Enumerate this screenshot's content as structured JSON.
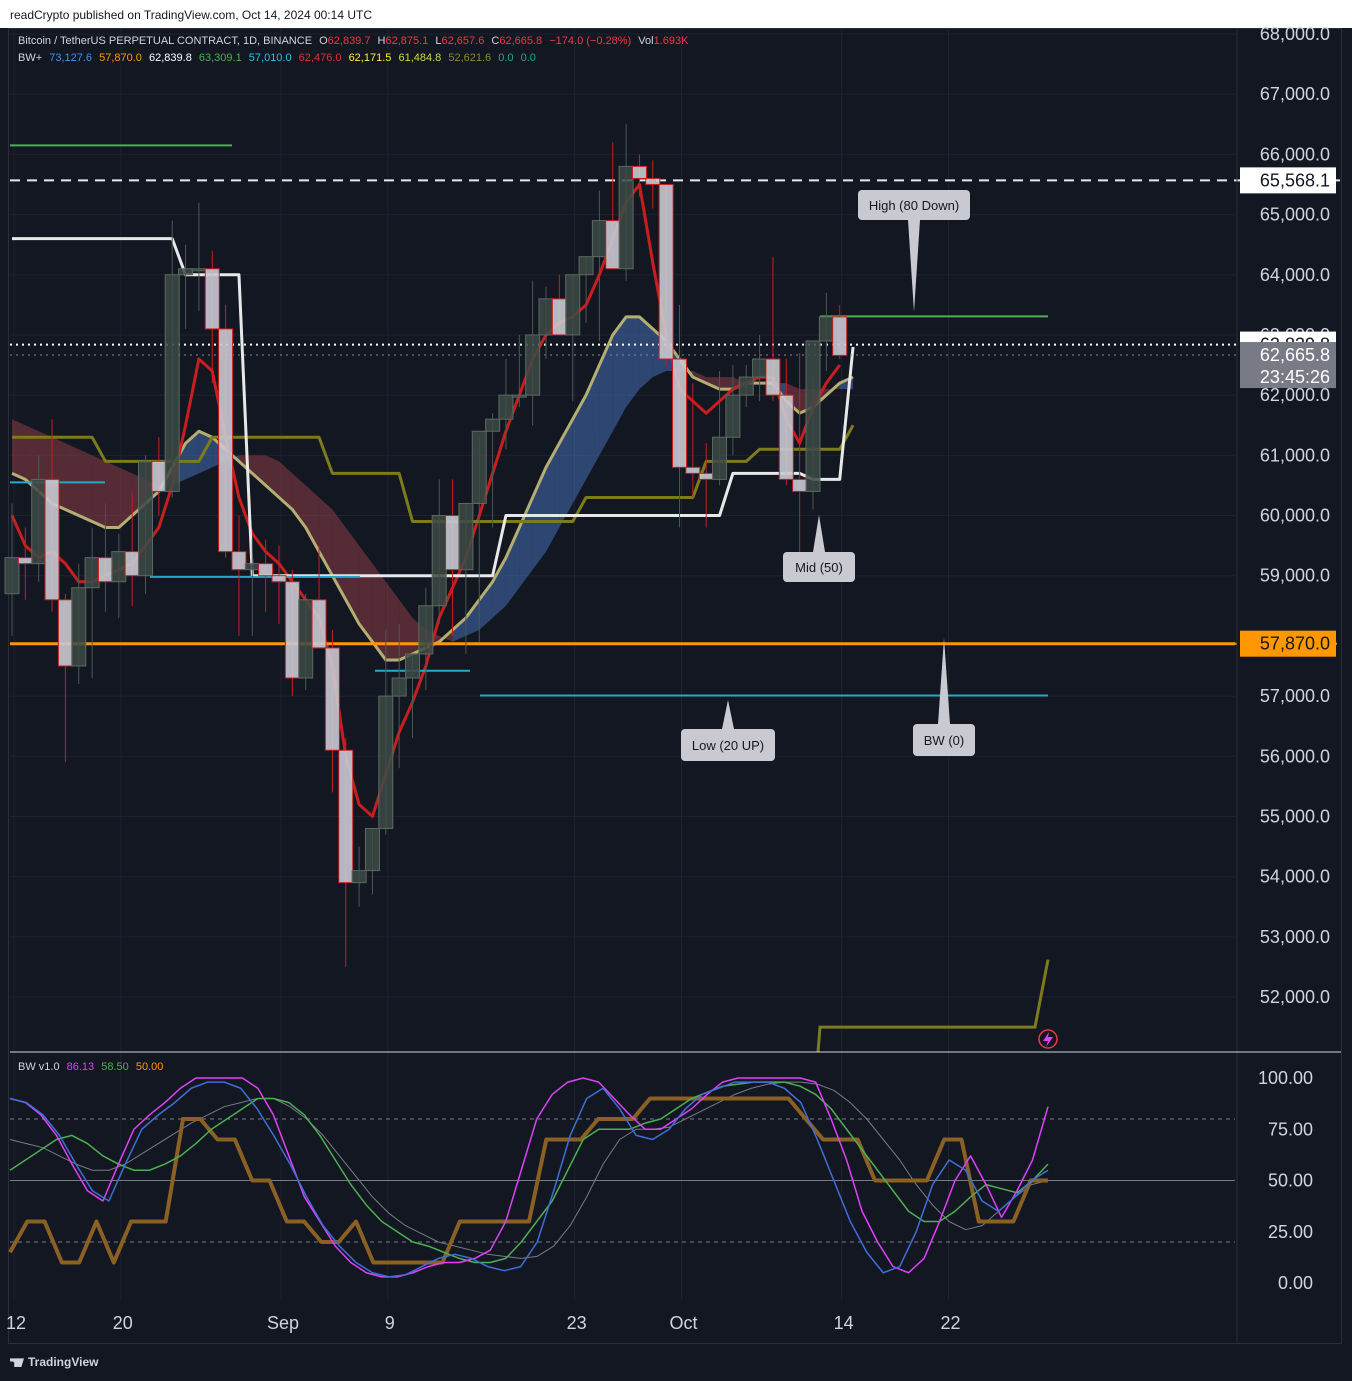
{
  "publisher": "readCrypto published on TradingView.com, Oct 14, 2024 00:14 UTC",
  "footer_brand": "TradingView",
  "colors": {
    "bg": "#131722",
    "up": "#4a5a50",
    "down": "#c8c8d0",
    "red": "#d11a1a",
    "white": "#e8e8e8",
    "olive": "#7d7b1b",
    "cyan": "#22aacc",
    "orange": "#ff9800",
    "green": "#4caf50",
    "pink": "#e040fb",
    "blue": "#3f6fd6",
    "ltgreen": "#6de05a",
    "brown": "#8a6023"
  },
  "legend": {
    "symbol": "Bitcoin / TetherUS PERPETUAL CONTRACT, 1D, BINANCE",
    "o_label": "O",
    "o": "62,839.7",
    "h_label": "H",
    "h": "62,875.1",
    "l_label": "L",
    "l": "62,657.6",
    "c_label": "C",
    "c": "62,665.8",
    "change": "−174.0 (−0.28%)",
    "vol_label": "Vol",
    "vol": "1.693K",
    "bw_label": "BW+",
    "bw_values": [
      "73,127.6",
      "57,870.0",
      "62,839.8",
      "63,309.1",
      "57,010.0",
      "62,476.0",
      "62,171.5",
      "61,484.8",
      "52,621.6",
      "0.0",
      "0.0"
    ],
    "bw_colors": [
      "#3f8ff6",
      "#ff9800",
      "#ffffff",
      "#4caf50",
      "#22c3e6",
      "#e03030",
      "#ffeb3b",
      "#cddc39",
      "#8a8a2a",
      "#22aa88",
      "#22aa88"
    ]
  },
  "osc_legend": {
    "name": "BW v1.0",
    "values": [
      "86.13",
      "58.50",
      "50.00"
    ],
    "colors": [
      "#e040fb",
      "#4caf50",
      "#ff9800"
    ]
  },
  "annotations": {
    "high": "High (80 Down)",
    "mid": "Mid (50)",
    "low": "Low (20 UP)",
    "bw": "BW (0)"
  },
  "price_badges": {
    "level_1": "65,568.1",
    "last": "62,839.8",
    "close": "62,665.8",
    "countdown": "23:45:26",
    "bw": "57,870.0"
  },
  "chart_data": [
    {
      "type": "candlestick",
      "title": "Bitcoin / TetherUS PERPETUAL CONTRACT, 1D, BINANCE",
      "y_ticks": [
        "68,000.0",
        "67,000.0",
        "66,000.0",
        "65,000.0",
        "64,000.0",
        "63,000.0",
        "62,000.0",
        "61,000.0",
        "60,000.0",
        "59,000.0",
        "57,000.0",
        "56,000.0",
        "55,000.0",
        "54,000.0",
        "53,000.0",
        "52,000.0"
      ],
      "y_tick_values": [
        68000,
        67000,
        66000,
        65000,
        64000,
        63000,
        62000,
        61000,
        60000,
        59000,
        57000,
        56000,
        55000,
        54000,
        53000,
        52000
      ],
      "x_ticks": [
        "12",
        "20",
        "Sep",
        "9",
        "23",
        "Oct",
        "14",
        "22"
      ],
      "x_tick_days": [
        0,
        8,
        20,
        28,
        42,
        50,
        62,
        70
      ],
      "ylim": [
        51100,
        68400
      ],
      "candles": [
        [
          58700,
          60200,
          58000,
          59300
        ],
        [
          59300,
          59800,
          58600,
          59200
        ],
        [
          59200,
          61000,
          58900,
          60600
        ],
        [
          60600,
          61600,
          58400,
          58600
        ],
        [
          58600,
          58700,
          55900,
          57500
        ],
        [
          57500,
          59200,
          57200,
          58800
        ],
        [
          58800,
          59800,
          57300,
          59300
        ],
        [
          59300,
          60200,
          58400,
          58900
        ],
        [
          58900,
          59700,
          58300,
          59400
        ],
        [
          59400,
          60400,
          58500,
          59000
        ],
        [
          59000,
          61000,
          58700,
          60900
        ],
        [
          60900,
          61300,
          60000,
          60400
        ],
        [
          60400,
          64900,
          60300,
          64000
        ],
        [
          64000,
          64500,
          63100,
          64100
        ],
        [
          64100,
          65200,
          63400,
          64100
        ],
        [
          64100,
          64400,
          62200,
          63100
        ],
        [
          63100,
          63500,
          59300,
          59400
        ],
        [
          59400,
          60000,
          58000,
          59100
        ],
        [
          59100,
          59600,
          58000,
          59200
        ],
        [
          59200,
          59600,
          58400,
          59000
        ],
        [
          59000,
          59500,
          58200,
          58900
        ],
        [
          58900,
          59100,
          57000,
          57300
        ],
        [
          57300,
          58700,
          57100,
          58600
        ],
        [
          58600,
          59500,
          57800,
          57800
        ],
        [
          57800,
          58100,
          55400,
          56100
        ],
        [
          56100,
          56300,
          52500,
          53900
        ],
        [
          53900,
          54500,
          53500,
          54100
        ],
        [
          54100,
          54800,
          53700,
          54800
        ],
        [
          54800,
          58100,
          54700,
          57000
        ],
        [
          57000,
          58200,
          55800,
          57300
        ],
        [
          57300,
          57700,
          56300,
          57700
        ],
        [
          57700,
          58800,
          57100,
          58500
        ],
        [
          58500,
          60600,
          58200,
          60000
        ],
        [
          60000,
          60600,
          58000,
          59100
        ],
        [
          59100,
          60200,
          57700,
          60200
        ],
        [
          60200,
          61300,
          57900,
          61400
        ],
        [
          61400,
          61700,
          59800,
          61600
        ],
        [
          61600,
          62600,
          61100,
          62000
        ],
        [
          62000,
          63000,
          61800,
          62000
        ],
        [
          62000,
          63900,
          61500,
          63000
        ],
        [
          63000,
          63800,
          62600,
          63600
        ],
        [
          63600,
          64000,
          63000,
          63000
        ],
        [
          63000,
          64000,
          61900,
          64000
        ],
        [
          64000,
          64300,
          63200,
          64300
        ],
        [
          64300,
          65400,
          62900,
          64900
        ],
        [
          64900,
          66200,
          64200,
          64100
        ],
        [
          64100,
          66500,
          63900,
          65800
        ],
        [
          65800,
          66000,
          65300,
          65600
        ],
        [
          65600,
          65900,
          65100,
          65500
        ],
        [
          65500,
          65500,
          62500,
          62600
        ],
        [
          62600,
          63500,
          59800,
          60800
        ],
        [
          60800,
          62200,
          60300,
          60700
        ],
        [
          60700,
          61200,
          59800,
          60600
        ],
        [
          60600,
          62400,
          60500,
          61300
        ],
        [
          61300,
          62500,
          61000,
          62000
        ],
        [
          62000,
          62500,
          61800,
          62300
        ],
        [
          62300,
          63000,
          61900,
          62600
        ],
        [
          62600,
          64300,
          61900,
          62000
        ],
        [
          62000,
          62600,
          60500,
          60600
        ],
        [
          60600,
          62700,
          58900,
          60400
        ],
        [
          60400,
          62300,
          60100,
          62900
        ],
        [
          62900,
          63700,
          62400,
          63300
        ],
        [
          63300,
          63500,
          62600,
          62660
        ]
      ],
      "series": [
        {
          "name": "BW+",
          "values": [
            62840,
            63309,
            62476,
            62171,
            61485,
            57870,
            57010
          ]
        }
      ]
    },
    {
      "type": "line",
      "title": "BW v1.0",
      "y_ticks": [
        "100.00",
        "75.00",
        "50.00",
        "25.00",
        "0.00"
      ],
      "y_tick_values": [
        100,
        75,
        50,
        25,
        0
      ],
      "ylim": [
        -5,
        105
      ],
      "series": [
        {
          "name": "86.13",
          "values": [
            90,
            88,
            82,
            72,
            58,
            45,
            40,
            58,
            75,
            82,
            88,
            95,
            100,
            100,
            100,
            100,
            95,
            82,
            62,
            42,
            30,
            18,
            10,
            5,
            3,
            3,
            5,
            8,
            10,
            10,
            12,
            16,
            30,
            55,
            80,
            92,
            98,
            100,
            98,
            90,
            82,
            75,
            75,
            80,
            85,
            92,
            98,
            100,
            100,
            100,
            100,
            100,
            98,
            80,
            60,
            35,
            20,
            8,
            5,
            12,
            30,
            50,
            62,
            48,
            32,
            45,
            60,
            86
          ]
        },
        {
          "name": "58.50",
          "values": [
            55,
            60,
            65,
            70,
            72,
            68,
            62,
            58,
            55,
            55,
            58,
            62,
            68,
            75,
            80,
            85,
            90,
            90,
            88,
            82,
            72,
            60,
            48,
            38,
            30,
            25,
            20,
            18,
            15,
            12,
            10,
            10,
            12,
            20,
            30,
            40,
            55,
            70,
            75,
            75,
            75,
            78,
            80,
            85,
            90,
            93,
            96,
            97,
            98,
            98,
            98,
            96,
            92,
            85,
            75,
            65,
            55,
            45,
            35,
            30,
            30,
            35,
            42,
            48,
            46,
            44,
            50,
            58
          ]
        },
        {
          "name": "50.00",
          "values": [
            15,
            30,
            30,
            10,
            10,
            30,
            10,
            30,
            30,
            30,
            80,
            80,
            70,
            70,
            50,
            50,
            30,
            30,
            20,
            20,
            30,
            10,
            10,
            10,
            10,
            10,
            30,
            30,
            30,
            30,
            30,
            70,
            70,
            70,
            80,
            80,
            80,
            90,
            90,
            90,
            90,
            90,
            90,
            90,
            90,
            90,
            80,
            70,
            70,
            70,
            50,
            50,
            50,
            50,
            70,
            70,
            30,
            30,
            30,
            50,
            50
          ]
        }
      ]
    }
  ]
}
